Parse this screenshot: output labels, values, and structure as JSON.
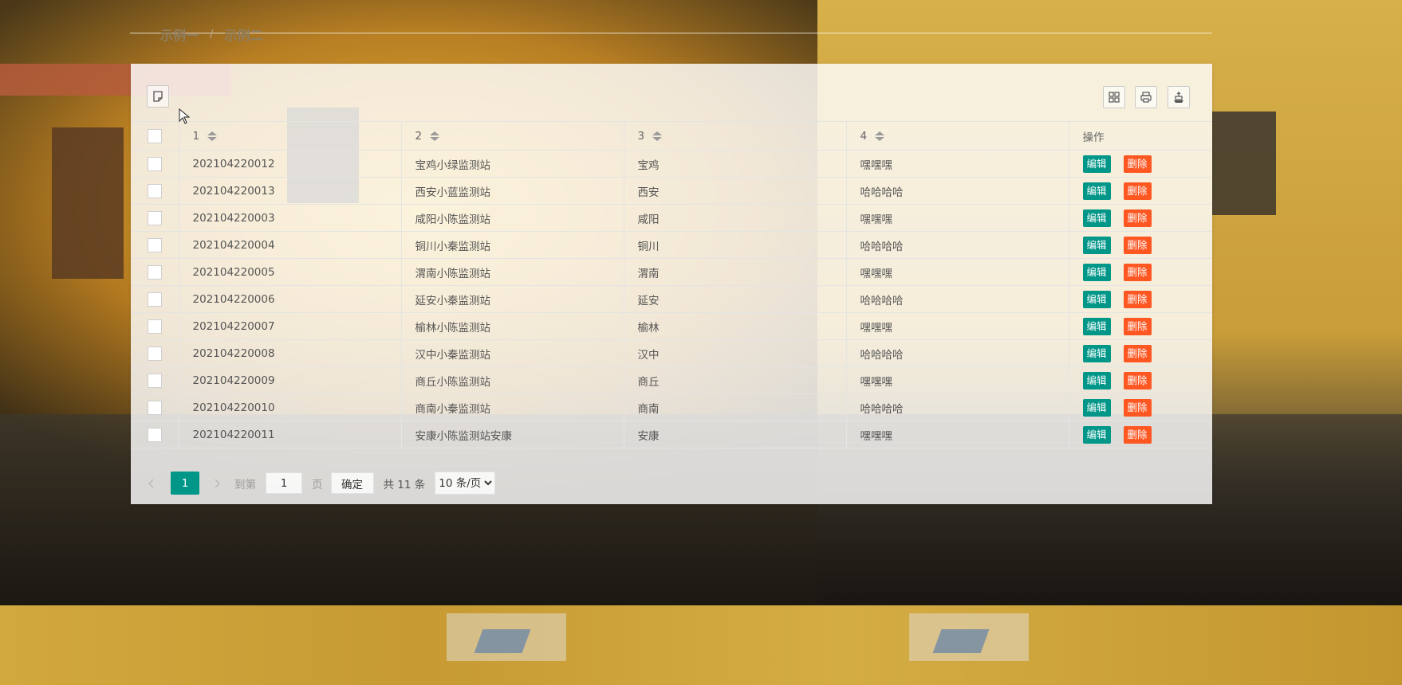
{
  "breadcrumb": {
    "items": [
      "示例一",
      "示例二"
    ],
    "separator": "/"
  },
  "toolbar": {
    "left_icon": "note-icon",
    "right_icons": [
      "columns-icon",
      "print-icon",
      "export-icon"
    ]
  },
  "table": {
    "columns": [
      "1",
      "2",
      "3",
      "4",
      "操作"
    ],
    "rows": [
      [
        "202104220012",
        "宝鸡小绿监测站",
        "宝鸡",
        "嘿嘿嘿"
      ],
      [
        "202104220013",
        "西安小蓝监测站",
        "西安",
        "哈哈哈哈"
      ],
      [
        "202104220003",
        "咸阳小陈监测站",
        "咸阳",
        "嘿嘿嘿"
      ],
      [
        "202104220004",
        "铜川小秦监测站",
        "铜川",
        "哈哈哈哈"
      ],
      [
        "202104220005",
        "渭南小陈监测站",
        "渭南",
        "嘿嘿嘿"
      ],
      [
        "202104220006",
        "延安小秦监测站",
        "延安",
        "哈哈哈哈"
      ],
      [
        "202104220007",
        "榆林小陈监测站",
        "榆林",
        "嘿嘿嘿"
      ],
      [
        "202104220008",
        "汉中小秦监测站",
        "汉中",
        "哈哈哈哈"
      ],
      [
        "202104220009",
        "商丘小陈监测站",
        "商丘",
        "嘿嘿嘿"
      ],
      [
        "202104220010",
        "商南小秦监测站",
        "商南",
        "哈哈哈哈"
      ],
      [
        "202104220011",
        "安康小陈监测站安康",
        "安康",
        "嘿嘿嘿"
      ]
    ],
    "edit_label": "编辑",
    "delete_label": "删除"
  },
  "pager": {
    "current_page": "1",
    "goto_label": "到第",
    "page_input": "1",
    "page_unit": "页",
    "confirm_label": "确定",
    "total_label": "共 11 条",
    "page_size": "10 条/页"
  },
  "colors": {
    "primary": "#009688",
    "danger": "#ff5722"
  }
}
